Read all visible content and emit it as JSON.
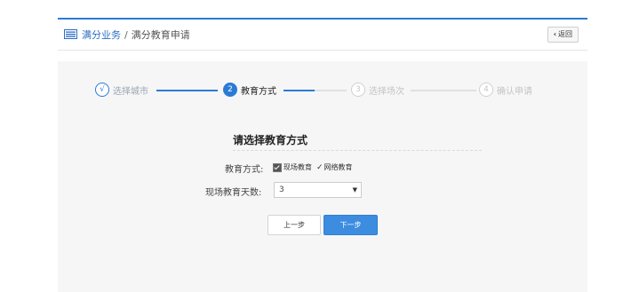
{
  "header": {
    "breadcrumb_main": "满分业务",
    "breadcrumb_separator": "/",
    "breadcrumb_current": "满分教育申请",
    "back_label": "返回",
    "accent_color": "#2b7bd6"
  },
  "steps": [
    {
      "marker": "√",
      "label": "选择城市",
      "state": "done"
    },
    {
      "marker": "2",
      "label": "教育方式",
      "state": "active"
    },
    {
      "marker": "3",
      "label": "选择场次",
      "state": "todo"
    },
    {
      "marker": "4",
      "label": "确认申请",
      "state": "todo"
    }
  ],
  "form": {
    "title": "请选择教育方式",
    "method_label": "教育方式:",
    "option_onsite": "现场教育",
    "option_online": "网络教育",
    "days_label": "现场教育天数:",
    "days_value": "3"
  },
  "buttons": {
    "prev": "上一步",
    "next": "下一步"
  }
}
